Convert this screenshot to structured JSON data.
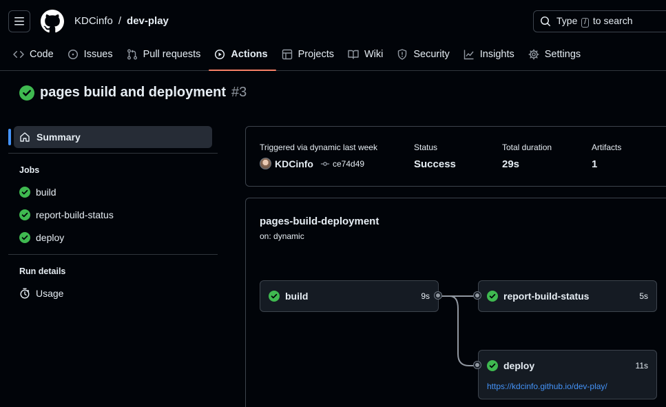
{
  "header": {
    "owner": "KDCinfo",
    "separator": "/",
    "repo": "dev-play",
    "search": {
      "prefix": "Type",
      "key": "/",
      "suffix": "to search"
    }
  },
  "tabs": [
    {
      "label": "Code",
      "icon": "code-icon"
    },
    {
      "label": "Issues",
      "icon": "issue-icon"
    },
    {
      "label": "Pull requests",
      "icon": "pull-request-icon"
    },
    {
      "label": "Actions",
      "icon": "play-icon",
      "active": true
    },
    {
      "label": "Projects",
      "icon": "table-icon"
    },
    {
      "label": "Wiki",
      "icon": "book-icon"
    },
    {
      "label": "Security",
      "icon": "shield-icon"
    },
    {
      "label": "Insights",
      "icon": "graph-icon"
    },
    {
      "label": "Settings",
      "icon": "gear-icon"
    }
  ],
  "run": {
    "title": "pages build and deployment",
    "number": "#3"
  },
  "sidebar": {
    "summary": "Summary",
    "jobs_heading": "Jobs",
    "jobs": [
      "build",
      "report-build-status",
      "deploy"
    ],
    "run_details_heading": "Run details",
    "usage": "Usage"
  },
  "summary": {
    "triggered": "Triggered via dynamic last week",
    "actor": "KDCinfo",
    "commit": "ce74d49",
    "status_label": "Status",
    "status_value": "Success",
    "duration_label": "Total duration",
    "duration_value": "29s",
    "artifacts_label": "Artifacts",
    "artifacts_value": "1"
  },
  "workflow": {
    "name": "pages-build-deployment",
    "on": "on: dynamic",
    "jobs": {
      "build": {
        "name": "build",
        "duration": "9s"
      },
      "report": {
        "name": "report-build-status",
        "duration": "5s"
      },
      "deploy": {
        "name": "deploy",
        "duration": "11s",
        "url": "https://kdcinfo.github.io/dev-play/"
      }
    }
  },
  "colors": {
    "success": "#3fb950",
    "accent": "#f78166",
    "link": "#4493f8"
  }
}
